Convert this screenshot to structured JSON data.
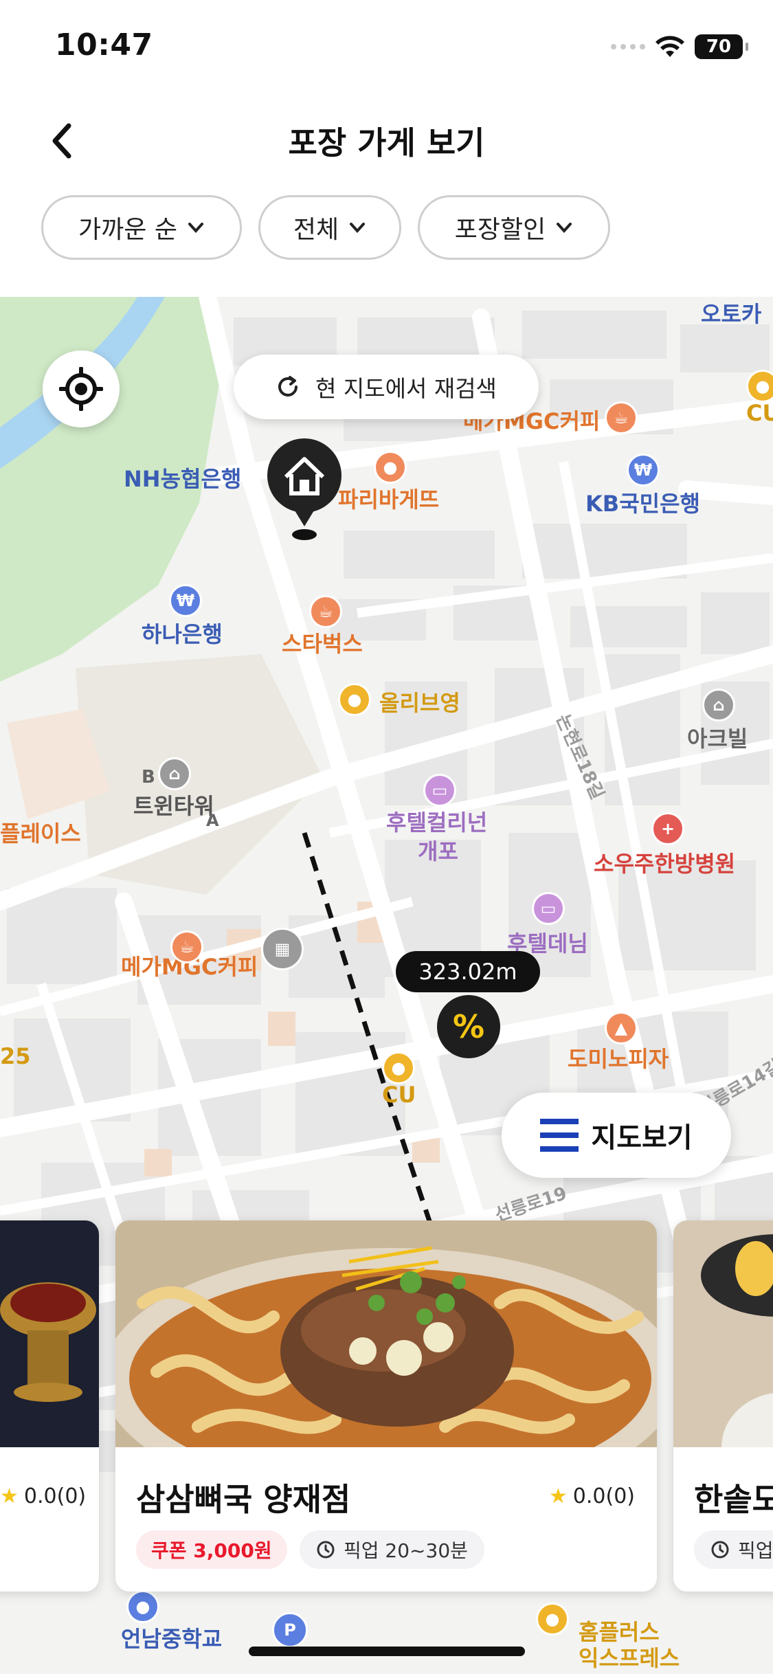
{
  "status_bar": {
    "time": "10:47",
    "battery": "70"
  },
  "header": {
    "title": "포장 가게 보기"
  },
  "filters": [
    {
      "label": "가까운 순"
    },
    {
      "label": "전체"
    },
    {
      "label": "포장할인"
    }
  ],
  "map": {
    "research_label": "현 지도에서 재검색",
    "distance": "323.02m",
    "store_marker_symbol": "%",
    "map_view_label": "지도보기",
    "pois": [
      "NH농협은행",
      "파리바게뜨",
      "메가MGC커피",
      "KB국민은행",
      "오토카",
      "하나은행",
      "스타벅스",
      "올리브영",
      "아크빌",
      "논현로18길",
      "트윈타워",
      "후텔컬리넌",
      "개포",
      "소우주한방병원",
      "플레이스",
      "후텔데님",
      "메가MGC커피",
      "도미노피자",
      "CU",
      "25",
      "CU",
      "선릉로14길",
      "선릉로19",
      "언남중학교",
      "홈플러스",
      "익스프레스",
      "B",
      "A"
    ]
  },
  "cards": [
    {
      "rating": "0.0(0)"
    },
    {
      "name": "삼삼뼈국 양재점",
      "rating": "0.0(0)",
      "coupon": "쿠폰 3,000원",
      "pickup": "픽업 20~30분"
    },
    {
      "name": "한솥도",
      "pickup": "픽업"
    }
  ],
  "colors": {
    "accent": "#1a3fb6",
    "coupon_red": "#e8192c",
    "marker_dark": "#1e1e1e",
    "percent_yellow": "#f4c514"
  }
}
